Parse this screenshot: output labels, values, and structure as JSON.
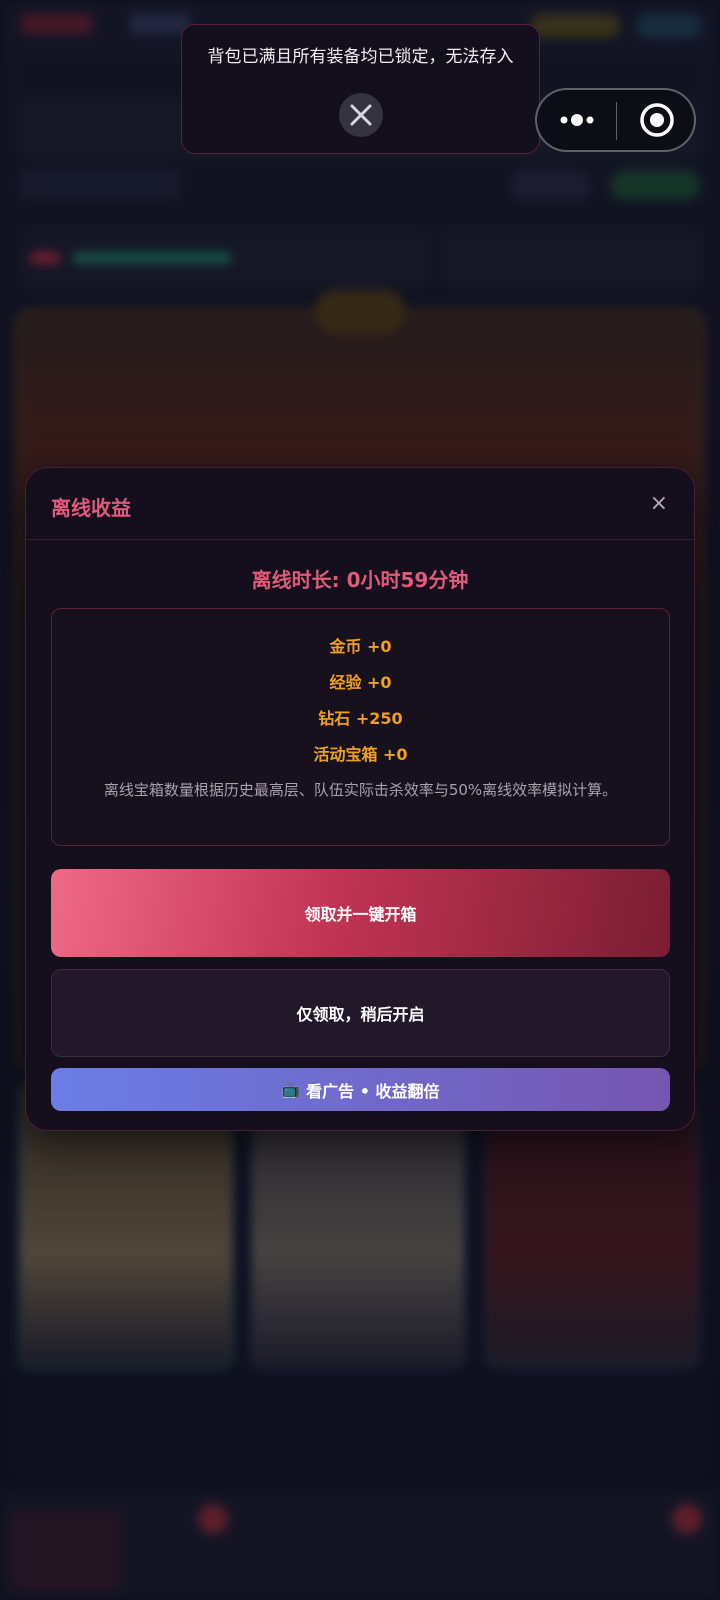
{
  "toast": {
    "message": "背包已满且所有装备均已锁定，无法存入",
    "close_icon": "close-icon"
  },
  "capsule": {
    "menu_icon": "more-dots-icon",
    "close_icon": "target-circle-icon"
  },
  "modal": {
    "title": "离线收益",
    "close_glyph": "×",
    "offline_time": "离线时长: 0小时59分钟",
    "rewards": [
      {
        "label": "金币 +0"
      },
      {
        "label": "经验 +0"
      },
      {
        "label": "钻石 +250"
      },
      {
        "label": "活动宝箱 +0"
      }
    ],
    "note": "离线宝箱数量根据历史最高层、队伍实际击杀效率与50%离线效率模拟计算。",
    "buttons": {
      "claim_open": "领取并一键开箱",
      "claim_only": "仅领取，稍后开启",
      "ad_icon": "📺",
      "ad_double": "看广告 • 收益翻倍"
    }
  },
  "colors": {
    "accent": "#e05a7a",
    "reward": "#f0a020",
    "modal_bg": "#150f1d"
  }
}
